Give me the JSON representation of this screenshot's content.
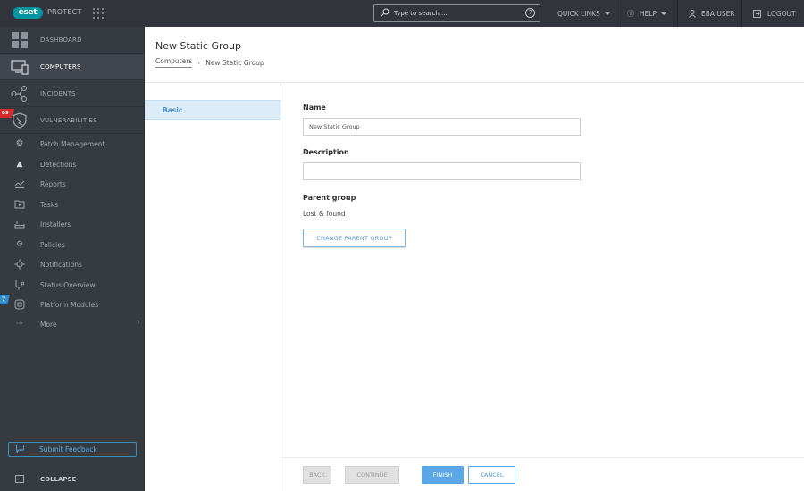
{
  "topbar": {
    "logo_text": "eset",
    "product_name": "PROTECT",
    "search": {
      "placeholder": "Type to search ...",
      "value": ""
    },
    "search_help": "?",
    "quick_links": "QUICK LINKS",
    "help": "HELP",
    "user": "EBA USER",
    "logout": "LOGOUT"
  },
  "sidebar": {
    "main_items": [
      {
        "label": "DASHBOARD",
        "icon": "dashboard-icon",
        "active": false
      },
      {
        "label": "COMPUTERS",
        "icon": "computers-icon",
        "active": true
      },
      {
        "label": "INCIDENTS",
        "icon": "incidents-icon",
        "active": false
      },
      {
        "label": "VULNERABILITIES",
        "icon": "vulnerabilities-icon",
        "active": false,
        "badge": "89"
      }
    ],
    "sub_items": [
      {
        "label": "Patch Management",
        "icon": "patch-icon"
      },
      {
        "label": "Detections",
        "icon": "warning-icon"
      },
      {
        "label": "Reports",
        "icon": "reports-icon"
      },
      {
        "label": "Tasks",
        "icon": "tasks-icon"
      },
      {
        "label": "Installers",
        "icon": "installers-icon"
      },
      {
        "label": "Policies",
        "icon": "policies-icon"
      },
      {
        "label": "Notifications",
        "icon": "notifications-icon"
      },
      {
        "label": "Status Overview",
        "icon": "status-icon"
      },
      {
        "label": "Platform Modules",
        "icon": "modules-icon",
        "badge": "7"
      },
      {
        "label": "More",
        "icon": "more-icon"
      }
    ],
    "feedback": "Submit Feedback",
    "collapse": "COLLAPSE"
  },
  "page": {
    "title": "New Static Group",
    "breadcrumb": {
      "parent": "Computers",
      "current": "New Static Group"
    }
  },
  "wizard": {
    "steps": [
      {
        "label": "Basic",
        "active": true
      }
    ]
  },
  "form": {
    "name_label": "Name",
    "name_value": "New Static Group",
    "description_label": "Description",
    "description_value": "",
    "parent_label": "Parent group",
    "parent_value": "Lost & found",
    "change_parent_button": "CHANGE PARENT GROUP"
  },
  "footer": {
    "back": "BACK",
    "continue": "CONTINUE",
    "finish": "FINISH",
    "cancel": "CANCEL"
  },
  "colors": {
    "topbar_bg": "#31343b",
    "sidebar_bg": "#363a41",
    "brand_teal": "#0096a1",
    "accent_blue": "#5aa6e6",
    "badge_red": "#d62a2a",
    "badge_blue": "#2f8fd1"
  }
}
